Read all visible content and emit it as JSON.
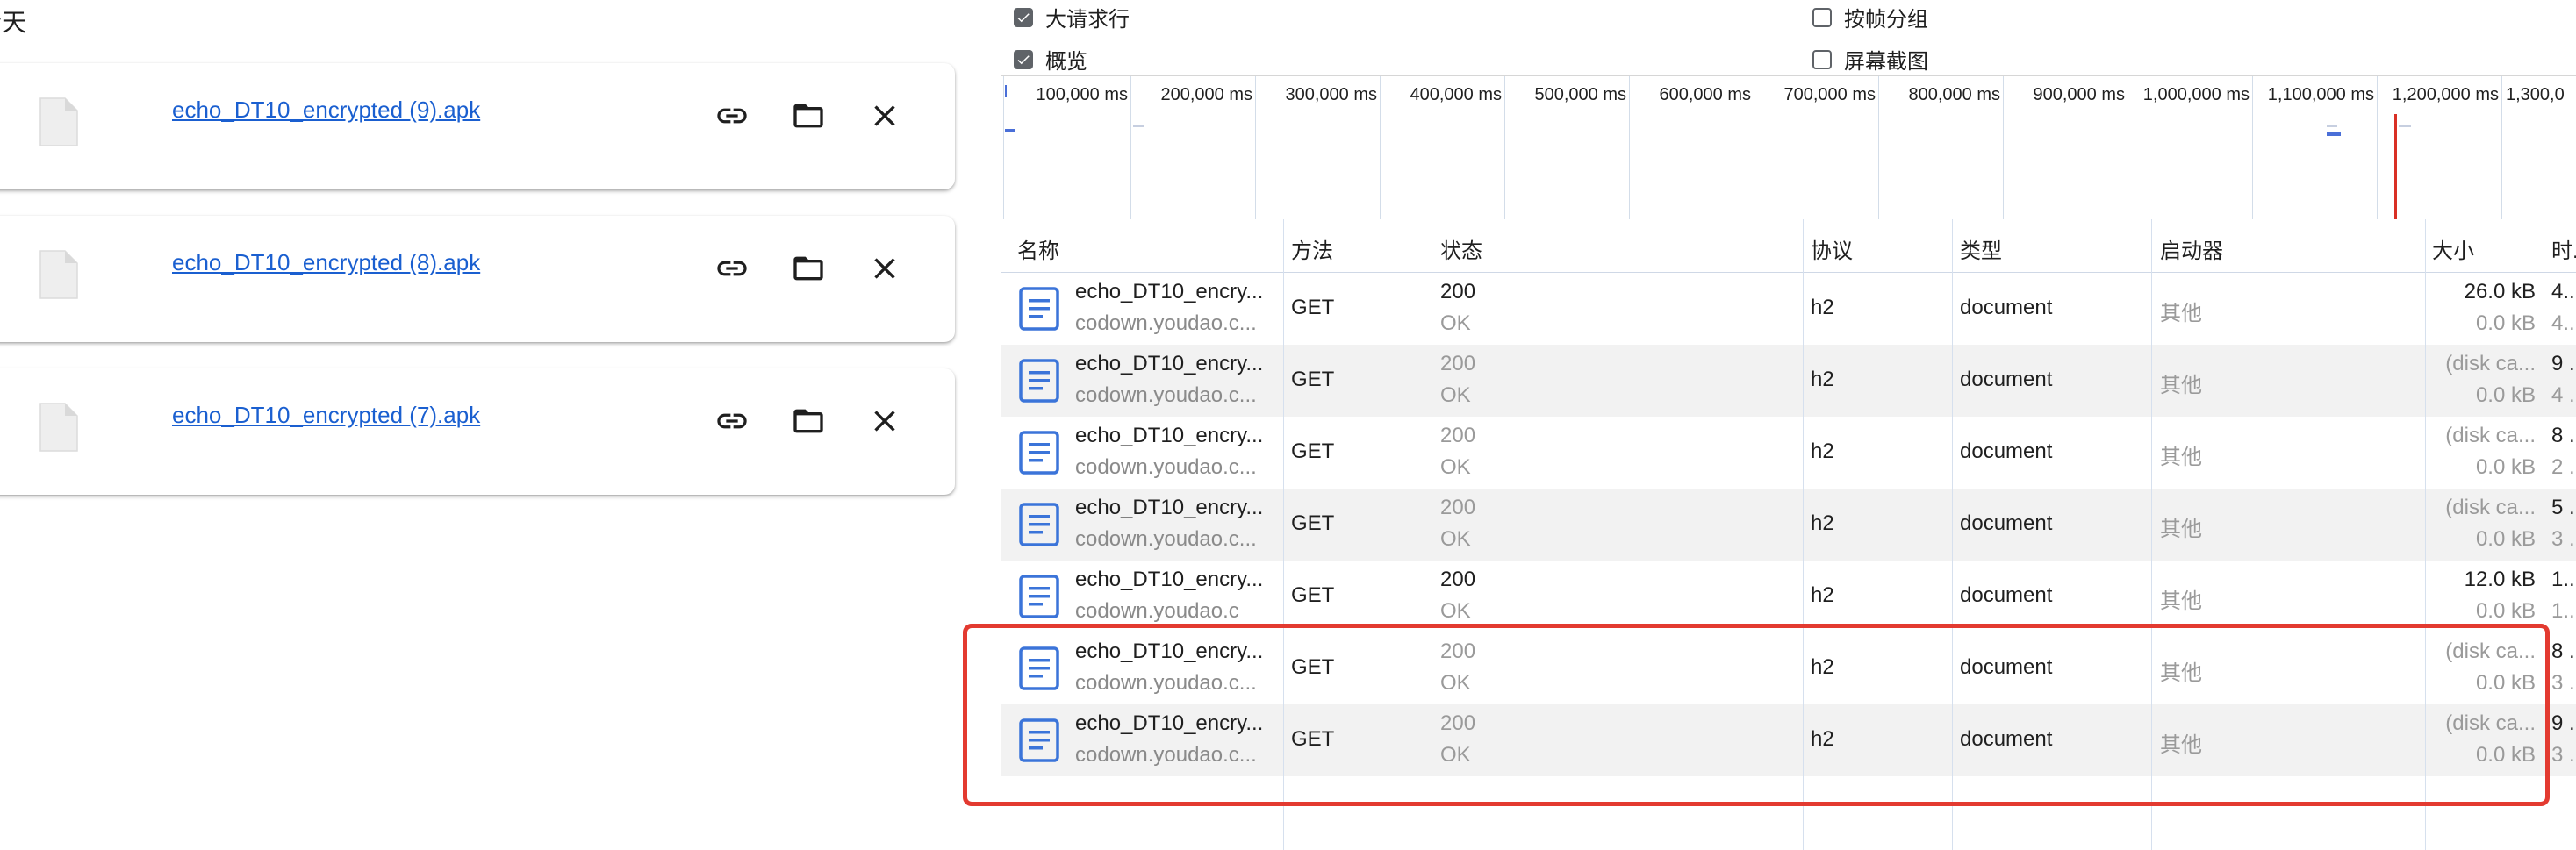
{
  "downloads": {
    "section_title": "今天",
    "items": [
      {
        "filename": "echo_DT10_encrypted (9).apk"
      },
      {
        "filename": "echo_DT10_encrypted (8).apk"
      },
      {
        "filename": "echo_DT10_encrypted (7).apk"
      }
    ],
    "item_actions": [
      "link-icon",
      "folder-icon",
      "close-icon"
    ]
  },
  "network": {
    "options": {
      "large_rows": {
        "label": "大请求行",
        "checked": true
      },
      "group_by_frame": {
        "label": "按帧分组",
        "checked": false
      },
      "overview": {
        "label": "概览",
        "checked": true
      },
      "screenshots": {
        "label": "屏幕截图",
        "checked": false
      }
    },
    "timeline_ticks": [
      "100,000 ms",
      "200,000 ms",
      "300,000 ms",
      "400,000 ms",
      "500,000 ms",
      "600,000 ms",
      "700,000 ms",
      "800,000 ms",
      "900,000 ms",
      "1,000,000 ms",
      "1,100,000 ms",
      "1,200,000 ms",
      "1,300,0"
    ],
    "columns": {
      "name": "名称",
      "method": "方法",
      "status": "状态",
      "protocol": "协议",
      "type": "类型",
      "initiator": "启动器",
      "size": "大小",
      "time": "时."
    },
    "rows": [
      {
        "name": "echo_DT10_encry...",
        "host": "codown.youdao.c...",
        "method": "GET",
        "status": "200",
        "status_text": "OK",
        "status_cached": false,
        "protocol": "h2",
        "type": "document",
        "initiator": "其他",
        "size": "26.0 kB",
        "size_sub": "0.0 kB",
        "time": "4..",
        "time_sub": "4.."
      },
      {
        "name": "echo_DT10_encry...",
        "host": "codown.youdao.c...",
        "method": "GET",
        "status": "200",
        "status_text": "OK",
        "status_cached": true,
        "protocol": "h2",
        "type": "document",
        "initiator": "其他",
        "size": "(disk ca...",
        "size_sub": "0.0 kB",
        "time": "9 ..",
        "time_sub": "4 .."
      },
      {
        "name": "echo_DT10_encry...",
        "host": "codown.youdao.c...",
        "method": "GET",
        "status": "200",
        "status_text": "OK",
        "status_cached": true,
        "protocol": "h2",
        "type": "document",
        "initiator": "其他",
        "size": "(disk ca...",
        "size_sub": "0.0 kB",
        "time": "8 ..",
        "time_sub": "2 .."
      },
      {
        "name": "echo_DT10_encry...",
        "host": "codown.youdao.c...",
        "method": "GET",
        "status": "200",
        "status_text": "OK",
        "status_cached": true,
        "protocol": "h2",
        "type": "document",
        "initiator": "其他",
        "size": "(disk ca...",
        "size_sub": "0.0 kB",
        "time": "5 ..",
        "time_sub": "3 .."
      },
      {
        "name": "echo_DT10_encry...",
        "host": "codown.youdao.c",
        "method": "GET",
        "status": "200",
        "status_text": "OK",
        "status_cached": false,
        "protocol": "h2",
        "type": "document",
        "initiator": "其他",
        "size": "12.0 kB",
        "size_sub": "0.0 kB",
        "time": "1...",
        "time_sub": "1..."
      },
      {
        "name": "echo_DT10_encry...",
        "host": "codown.youdao.c...",
        "method": "GET",
        "status": "200",
        "status_text": "OK",
        "status_cached": true,
        "protocol": "h2",
        "type": "document",
        "initiator": "其他",
        "size": "(disk ca...",
        "size_sub": "0.0 kB",
        "time": "8 ..",
        "time_sub": "3 .."
      },
      {
        "name": "echo_DT10_encry...",
        "host": "codown.youdao.c...",
        "method": "GET",
        "status": "200",
        "status_text": "OK",
        "status_cached": true,
        "protocol": "h2",
        "type": "document",
        "initiator": "其他",
        "size": "(disk ca...",
        "size_sub": "0.0 kB",
        "time": "9 ..",
        "time_sub": "3 .."
      }
    ]
  },
  "colors": {
    "link": "#1a5fd0",
    "highlight": "#e33a30",
    "doc_icon": "#3b74d9",
    "timeline_marker": "#d93025"
  }
}
